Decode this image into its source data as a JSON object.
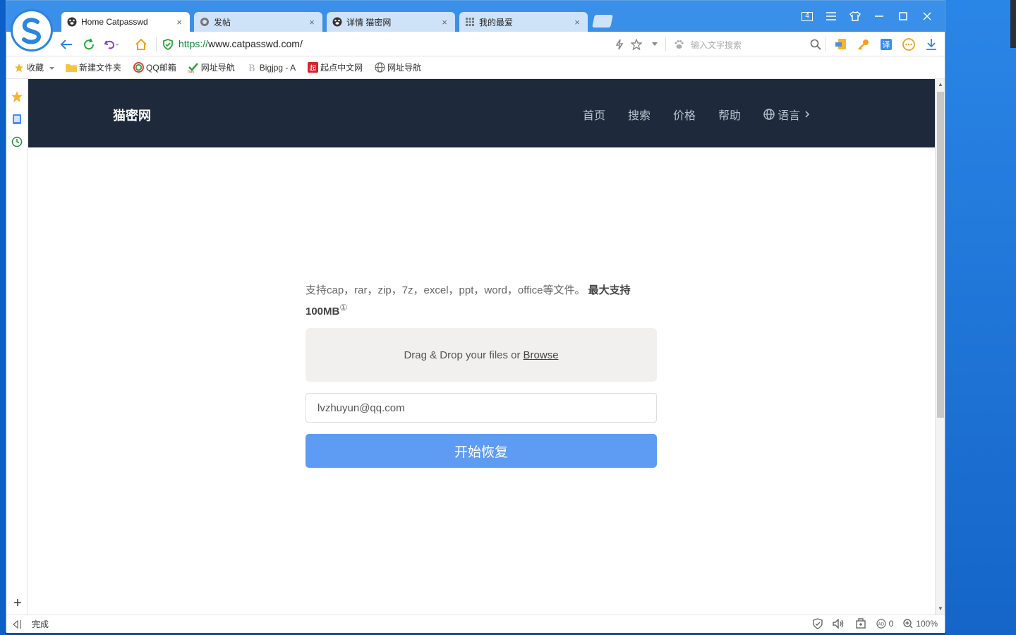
{
  "browser": {
    "tabs": [
      {
        "label": "Home Catpasswd",
        "icon": "paw-icon",
        "active": true
      },
      {
        "label": "发帖",
        "icon": "gear-icon",
        "active": false
      },
      {
        "label": "详情 猫密网",
        "icon": "paw-icon",
        "active": false
      },
      {
        "label": "我的最爱",
        "icon": "grid-icon",
        "active": false
      }
    ],
    "tab_close": "×",
    "window_badge": "4",
    "url_scheme": "https://",
    "url_rest": "www.catpasswd.com/",
    "search_placeholder": "输入文字搜索",
    "bookmarks": [
      {
        "label": "收藏",
        "icon": "star-icon"
      },
      {
        "label": "新建文件夹",
        "icon": "folder-icon"
      },
      {
        "label": "QQ邮箱",
        "icon": "qq-mail-icon"
      },
      {
        "label": "网址导航",
        "icon": "hao-icon"
      },
      {
        "label": "Bigjpg - A",
        "icon": "bigjpg-icon"
      },
      {
        "label": "起点中文网",
        "icon": "qidian-icon"
      },
      {
        "label": "网址导航",
        "icon": "globe-icon"
      }
    ],
    "status_text": "完成",
    "status_count": "0",
    "zoom": "100%"
  },
  "site": {
    "brand": "猫密网",
    "nav": [
      "首页",
      "搜索",
      "价格",
      "帮助"
    ],
    "language": "语言",
    "desc_main": "支持cap，rar，zip，7z，excel，ppt，word，office等文件。",
    "desc_bold": "最大支持100MB",
    "desc_sup": "①",
    "dropzone_text": "Drag & Drop your files or",
    "dropzone_link": "Browse",
    "email_value": "lvzhuyun@qq.com",
    "start_button": "开始恢复"
  },
  "colors": {
    "titlebar": "#3a8fe8",
    "site_header": "#1e2a3b",
    "primary_button": "#5e9bf3",
    "dropzone_bg": "#f1f0ef"
  }
}
